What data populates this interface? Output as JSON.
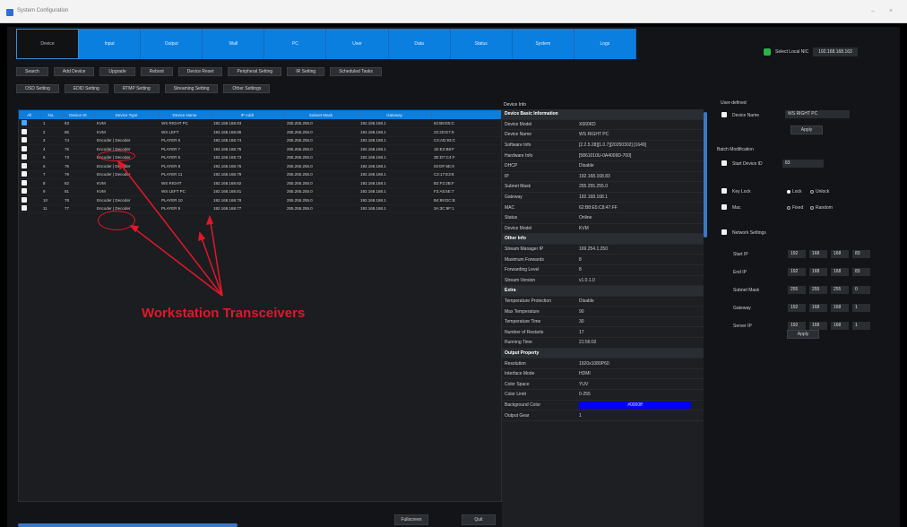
{
  "window": {
    "title": "System Configuration",
    "min": "–",
    "close": "×"
  },
  "tabs": [
    "Device",
    "Input",
    "Output",
    "Wall",
    "PC",
    "User",
    "Data",
    "Status",
    "System",
    "Logs"
  ],
  "nic": {
    "label": "Select Local NIC",
    "ip": "192.168.168.163"
  },
  "toolbar1": [
    "Search",
    "Add Device",
    "Upgrade",
    "Reboot",
    "Device Reset",
    "Peripheral Setting",
    "IR Setting",
    "Scheduled Tasks"
  ],
  "toolbar2": [
    "OSD Setting",
    "EDID Setting",
    "RTMP Setting",
    "Streaming Setting",
    "Other Settings"
  ],
  "table": {
    "headers": [
      "All",
      "No.",
      "Device ID",
      "Device Type",
      "Device Name",
      "IP Addr",
      "Subnet Mask",
      "Gateway",
      ""
    ],
    "rows": [
      [
        true,
        "1",
        "83",
        "KVM",
        "WS RIGHT PC",
        "192.168.168.83",
        "255.255.255.0",
        "192.168.168.1",
        "62:B8:E5:C"
      ],
      [
        false,
        "2",
        "85",
        "KVM",
        "WS LEFT",
        "192.168.168.85",
        "255.255.255.0",
        "192.168.168.1",
        "22:2D:E7:9"
      ],
      [
        false,
        "3",
        "74",
        "Encoder | Decoder",
        "PLAYER 6",
        "192.168.168.74",
        "255.255.255.0",
        "192.168.168.1",
        "C4:AD:93:C"
      ],
      [
        false,
        "4",
        "75",
        "Encoder | Decoder",
        "PLAYER 7",
        "192.168.168.75",
        "255.255.255.0",
        "192.168.168.1",
        "1E:E2:B8:F"
      ],
      [
        false,
        "5",
        "73",
        "Encoder | Decoder",
        "PLAYER 5",
        "192.168.168.73",
        "255.255.255.0",
        "192.168.168.1",
        "3E:D7:C4:F"
      ],
      [
        false,
        "6",
        "76",
        "Encoder | Decoder",
        "PLAYER 8",
        "192.168.168.76",
        "255.255.255.0",
        "192.168.168.1",
        "02:DF:6E:9"
      ],
      [
        false,
        "7",
        "79",
        "Encoder | Decoder",
        "PLAYER 11",
        "192.168.168.79",
        "255.255.255.0",
        "192.168.168.1",
        "C2:17:E3:8"
      ],
      [
        false,
        "8",
        "82",
        "KVM",
        "WS RIGHT",
        "192.168.168.82",
        "255.255.255.0",
        "192.168.168.1",
        "B2:F2:2B:F"
      ],
      [
        false,
        "9",
        "81",
        "KVM",
        "WS LEFT PC",
        "192.168.168.81",
        "255.255.255.0",
        "192.168.168.1",
        "F2:A5:5E:7"
      ],
      [
        false,
        "10",
        "78",
        "Encoder | Decoder",
        "PLAYER 10",
        "192.168.168.78",
        "255.255.255.0",
        "192.168.168.1",
        "B4:89:DC:B"
      ],
      [
        false,
        "11",
        "77",
        "Encoder | Decoder",
        "PLAYER 9",
        "192.168.168.77",
        "255.255.255.0",
        "192.168.168.1",
        "3A:3C:9F:1"
      ]
    ]
  },
  "annotation": "Workstation Transceivers",
  "info": {
    "title": "Device Info",
    "rows": [
      {
        "k": "Device Basic Information",
        "v": "",
        "sec": true
      },
      {
        "k": "Device Model",
        "v": "X660KD"
      },
      {
        "k": "Device Name",
        "v": "WS RIGHT PC"
      },
      {
        "k": "Software Info",
        "v": "[2.2.5.28][1.0.7][20250302] [1649]"
      },
      {
        "k": "Hardware Info",
        "v": "[5861010U-0A4009D-700]"
      },
      {
        "k": "DHCP",
        "v": "Disable"
      },
      {
        "k": "IP",
        "v": "192.168.168.83"
      },
      {
        "k": "Subnet Mask",
        "v": "255.255.255.0"
      },
      {
        "k": "Gateway",
        "v": "192.168.168.1"
      },
      {
        "k": "MAC",
        "v": "62:B8:E5:C8:47:FF"
      },
      {
        "k": "Status",
        "v": "Online"
      },
      {
        "k": "Device Model",
        "v": "KVM"
      },
      {
        "k": "Other Info",
        "v": "",
        "sec": true
      },
      {
        "k": "Stream Manager IP",
        "v": "169.254.1.250"
      },
      {
        "k": "Maximum Forwards",
        "v": "8"
      },
      {
        "k": "Forwarding Level",
        "v": "8"
      },
      {
        "k": "Stream Version",
        "v": "v1.0.1.0"
      },
      {
        "k": "Extra",
        "v": "",
        "sec": true
      },
      {
        "k": "Temperature Protection",
        "v": "Disable"
      },
      {
        "k": "Max Temperature",
        "v": "90"
      },
      {
        "k": "Temperature Time",
        "v": "30"
      },
      {
        "k": "Number of Restarts",
        "v": "17"
      },
      {
        "k": "Running Time",
        "v": "21:56:02"
      },
      {
        "k": "Output Property",
        "v": "",
        "sec": true
      },
      {
        "k": "Resolution",
        "v": "1920x1080P60"
      },
      {
        "k": "Interface Mode",
        "v": "HDMI"
      },
      {
        "k": "Color Space",
        "v": "YUV"
      },
      {
        "k": "Color Limit",
        "v": "0-255"
      },
      {
        "k": "Background Color",
        "v": "#0000ff",
        "bar": true
      },
      {
        "k": "Output Gear",
        "v": "1"
      }
    ]
  },
  "side": {
    "user_defined": "User-defined",
    "device_name_label": "Device Name",
    "device_name_value": "WS RIGHT PC",
    "apply": "Apply",
    "batch": "Batch Modification",
    "start_id_label": "Start Device ID",
    "start_id_value": "83",
    "key_lock": "Key Lock",
    "lock": "Lock",
    "unlock": "Unlock",
    "mac": "Mac",
    "fixed": "Fixed",
    "random": "Random",
    "network": "Network Settings",
    "start_ip": "Start IP",
    "end_ip": "End IP",
    "subnet": "Subnet Mask",
    "gateway": "Gateway",
    "server_ip": "Server IP",
    "start_ip_vals": [
      "192",
      "168",
      "168",
      "83"
    ],
    "end_ip_vals": [
      "192",
      "168",
      "168",
      "83"
    ],
    "subnet_vals": [
      "255",
      "255",
      "255",
      "0"
    ],
    "gateway_vals": [
      "192",
      "168",
      "168",
      "1"
    ],
    "server_ip_vals": [
      "192",
      "168",
      "168",
      "1"
    ],
    "apply2": "Apply"
  },
  "bottom": {
    "fullscreen": "Fullscreen",
    "quit": "Quit"
  }
}
